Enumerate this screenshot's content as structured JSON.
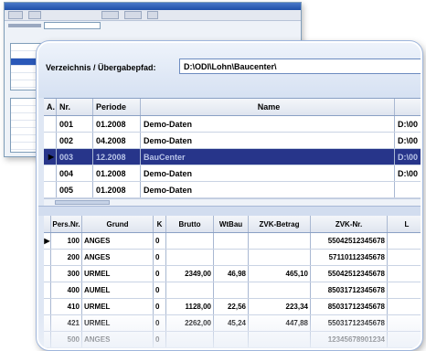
{
  "main": {
    "path_label": "Verzeichnis / Übergabepfad:",
    "path_value": "D:\\ODI\\Lohn\\Baucenter\\",
    "grid_periods": {
      "headers": [
        "A.",
        "Nr.",
        "Periode",
        "Name",
        ""
      ],
      "rows": [
        {
          "indicator": "",
          "nr": "001",
          "periode": "01.2008",
          "name": "Demo-Daten",
          "tail": "D:\\00"
        },
        {
          "indicator": "",
          "nr": "002",
          "periode": "04.2008",
          "name": "Demo-Daten",
          "tail": "D:\\00"
        },
        {
          "indicator": "▶",
          "nr": "003",
          "periode": "12.2008",
          "name": "BauCenter",
          "tail": "D:\\00",
          "selected": true
        },
        {
          "indicator": "",
          "nr": "004",
          "periode": "01.2008",
          "name": "Demo-Daten",
          "tail": "D:\\00"
        },
        {
          "indicator": "",
          "nr": "005",
          "periode": "01.2008",
          "name": "Demo-Daten",
          "tail": ""
        }
      ]
    },
    "grid_employees": {
      "headers": [
        "Pers.Nr.",
        "Grund",
        "K",
        "Brutto",
        "WtBau",
        "ZVK-Betrag",
        "ZVK-Nr.",
        "L"
      ],
      "rows": [
        {
          "ind": "▶",
          "pnr": "100",
          "grund": "ANGES",
          "k": "0",
          "brutto": "",
          "wtbau": "",
          "zvkb": "",
          "zvknr": "55042512345678"
        },
        {
          "ind": "",
          "pnr": "200",
          "grund": "ANGES",
          "k": "0",
          "brutto": "",
          "wtbau": "",
          "zvkb": "",
          "zvknr": "57110112345678"
        },
        {
          "ind": "",
          "pnr": "300",
          "grund": "URMEL",
          "k": "0",
          "brutto": "2349,00",
          "wtbau": "46,98",
          "zvkb": "465,10",
          "zvknr": "55042512345678"
        },
        {
          "ind": "",
          "pnr": "400",
          "grund": "AUMEL",
          "k": "0",
          "brutto": "",
          "wtbau": "",
          "zvkb": "",
          "zvknr": "85031712345678"
        },
        {
          "ind": "",
          "pnr": "410",
          "grund": "URMEL",
          "k": "0",
          "brutto": "1128,00",
          "wtbau": "22,56",
          "zvkb": "223,34",
          "zvknr": "85031712345678"
        },
        {
          "ind": "",
          "pnr": "421",
          "grund": "URMEL",
          "k": "0",
          "brutto": "2262,00",
          "wtbau": "45,24",
          "zvkb": "447,88",
          "zvknr": "55031712345678"
        },
        {
          "ind": "",
          "pnr": "500",
          "grund": "ANGES",
          "k": "0",
          "brutto": "",
          "wtbau": "",
          "zvkb": "",
          "zvknr": "12345678901234"
        }
      ]
    }
  },
  "colors": {
    "selection": "#27358a",
    "frame": "#dfe7f4",
    "title_blue": "#1f4fa8"
  }
}
